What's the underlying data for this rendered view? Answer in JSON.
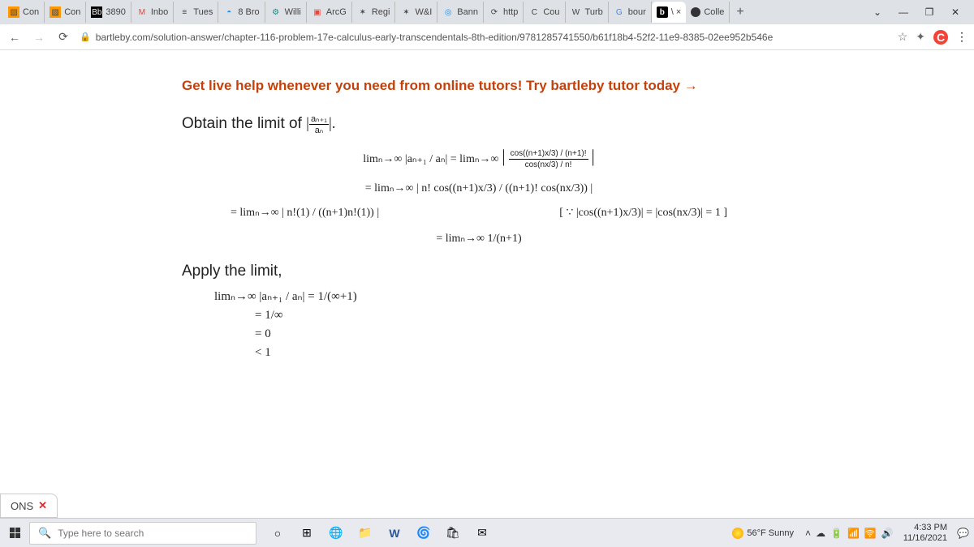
{
  "tabs": [
    {
      "fav": "▧",
      "cls": "f-orange",
      "label": "Con"
    },
    {
      "fav": "▧",
      "cls": "f-orange",
      "label": "Con"
    },
    {
      "fav": "Bb",
      "cls": "f-blk",
      "label": "3890"
    },
    {
      "fav": "M",
      "cls": "f-gm",
      "label": "Inbo"
    },
    {
      "fav": "≡",
      "cls": "f-list",
      "label": "Tues"
    },
    {
      "fav": "◓",
      "cls": "f-blue",
      "label": "8 Bro"
    },
    {
      "fav": "⚙",
      "cls": "f-teal",
      "label": "Willi"
    },
    {
      "fav": "▣",
      "cls": "f-red",
      "label": "ArcG"
    },
    {
      "fav": "✶",
      "cls": "",
      "label": "Regi"
    },
    {
      "fav": "✶",
      "cls": "",
      "label": "W&I"
    },
    {
      "fav": "◎",
      "cls": "f-blue",
      "label": "Bann"
    },
    {
      "fav": "⟳",
      "cls": "",
      "label": "http"
    },
    {
      "fav": "C",
      "cls": "",
      "label": "Cou"
    },
    {
      "fav": "W",
      "cls": "",
      "label": "Turb"
    },
    {
      "fav": "G",
      "cls": "f-g",
      "label": "bour"
    }
  ],
  "active_tab": {
    "fav": "b",
    "cls": "f-b",
    "label": "\\ ×"
  },
  "last_tab": {
    "fav": "●",
    "cls": "f-dk",
    "label": "Colle"
  },
  "addr": {
    "url": "bartleby.com/solution-answer/chapter-116-problem-17e-calculus-early-transcendentals-8th-edition/9781285741550/b61f18b4-52f2-11e9-8385-02ee952b546e"
  },
  "banner": {
    "text": "Get live help whenever you need from online tutors!  Try bartleby tutor today →"
  },
  "card": {
    "title_prefix": "Obtain the limit of ",
    "ratio_top": "aₙ₊₁",
    "ratio_bot": "aₙ",
    "apply": "Apply the limit,"
  },
  "equations": {
    "line1_lhs": "limₙ→∞ |aₙ₊₁ / aₙ| = limₙ→∞",
    "line1_rhs_top": "cos((n+1)x/3) / (n+1)!",
    "line1_rhs_bot": "cos(nx/3) / n!",
    "line2": "= limₙ→∞ | n! cos((n+1)x/3) / ((n+1)! cos(nx/3)) |",
    "line3_lhs": "= limₙ→∞ | n!(1) / ((n+1)n!(1)) |",
    "line3_rhs": "[ ∵ |cos((n+1)x/3)| = |cos(nx/3)| = 1 ]",
    "line4": "= limₙ→∞ 1/(n+1)",
    "result1": "limₙ→∞ |aₙ₊₁ / aₙ| = 1/(∞+1)",
    "result2": "= 1/∞",
    "result3": "= 0",
    "result4": "< 1"
  },
  "ons": {
    "label": "ONS",
    "close": "✕"
  },
  "taskbar": {
    "search_placeholder": "Type here to search",
    "weather": "56°F  Sunny",
    "time": "4:33 PM",
    "date": "11/16/2021"
  },
  "chart_data": null
}
